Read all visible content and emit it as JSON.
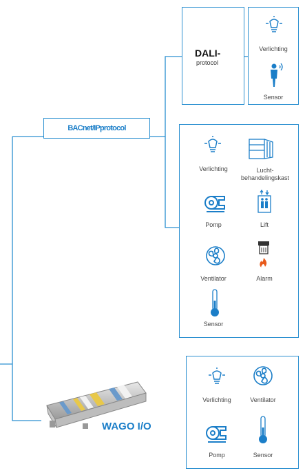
{
  "protocol_bus": {
    "label": "BACnet/IPprotocol"
  },
  "dali": {
    "title": "DALI-",
    "subtitle": "protocol",
    "devices": [
      {
        "label": "Verlichting",
        "icon": "lightbulb-icon"
      },
      {
        "label": "Sensor",
        "icon": "motion-sensor-icon"
      }
    ]
  },
  "bacnet_devices": [
    {
      "label": "Verlichting",
      "icon": "lightbulb-icon"
    },
    {
      "label": "Lucht-",
      "label2": "behandelingskast",
      "icon": "air-handling-unit-icon"
    },
    {
      "label": "Pomp",
      "icon": "pump-icon"
    },
    {
      "label": "Lift",
      "icon": "elevator-icon"
    },
    {
      "label": "Ventilator",
      "icon": "fan-icon"
    },
    {
      "label": "Alarm",
      "icon": "fire-alarm-icon"
    },
    {
      "label": "Sensor",
      "icon": "thermometer-icon"
    }
  ],
  "wago": {
    "label": "WAGO I/O",
    "devices": [
      {
        "label": "Verlichting",
        "icon": "lightbulb-icon"
      },
      {
        "label": "Ventilator",
        "icon": "fan-icon"
      },
      {
        "label": "Pomp",
        "icon": "pump-icon"
      },
      {
        "label": "Sensor",
        "icon": "thermometer-icon"
      }
    ]
  },
  "colors": {
    "line": "#2a8fd0",
    "icon": "#1b7ec8",
    "alarm": "#e85a1b"
  }
}
